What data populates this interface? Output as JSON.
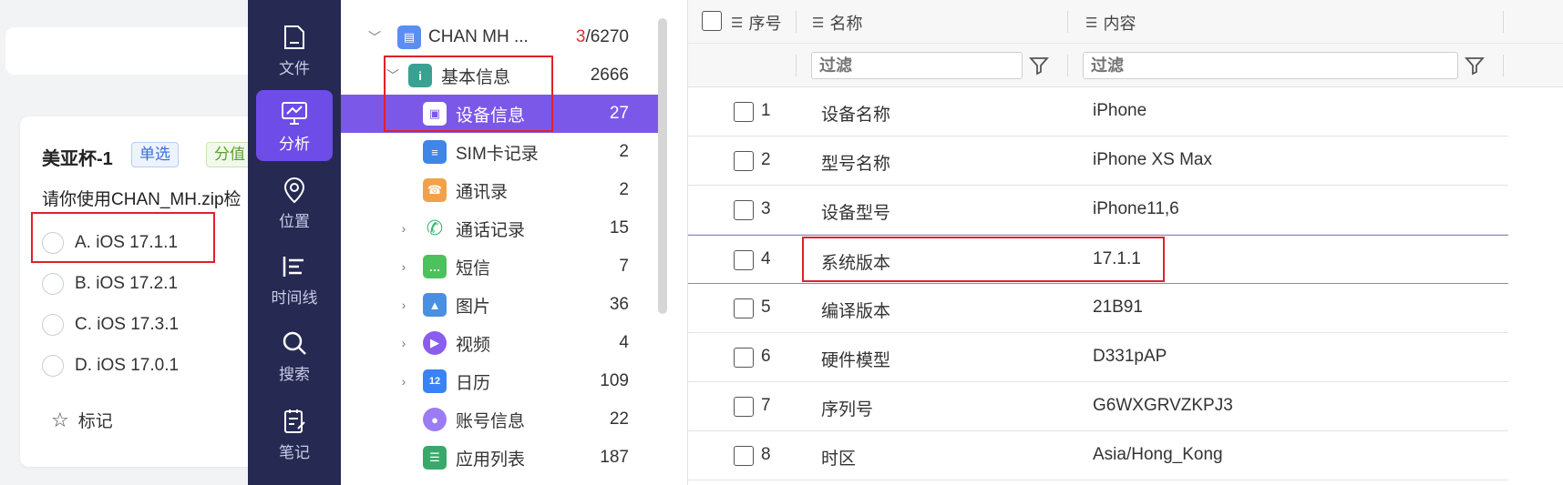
{
  "question": {
    "title": "美亚杯-1",
    "type_badge": "单选",
    "score_badge": "分值",
    "text": "请你使用CHAN_MH.zip检",
    "options": [
      "A. iOS 17.1.1",
      "B. iOS 17.2.1",
      "C. iOS 17.3.1",
      "D. iOS 17.0.1"
    ],
    "mark_label": "标记"
  },
  "nav": [
    {
      "label": "文件",
      "icon": "file-icon"
    },
    {
      "label": "分析",
      "icon": "monitor-icon"
    },
    {
      "label": "位置",
      "icon": "location-icon"
    },
    {
      "label": "时间线",
      "icon": "timeline-icon"
    },
    {
      "label": "搜索",
      "icon": "search-icon"
    },
    {
      "label": "笔记",
      "icon": "note-icon"
    }
  ],
  "tree": {
    "root": {
      "label": "CHAN MH ...",
      "count_highlight": "3",
      "count_rest": "/6270"
    },
    "items": [
      {
        "label": "基本信息",
        "count": "2666",
        "icon": "info-icon",
        "color": "#3aa192"
      },
      {
        "label": "设备信息",
        "count": "27",
        "icon": "device-icon",
        "color": "#5b8ef0"
      },
      {
        "label": "SIM卡记录",
        "count": "2",
        "icon": "sim-icon",
        "color": "#3f86e6"
      },
      {
        "label": "通讯录",
        "count": "2",
        "icon": "contacts-icon",
        "color": "#f0a24a"
      },
      {
        "label": "通话记录",
        "count": "15",
        "icon": "phone-icon",
        "color": "#3cb371"
      },
      {
        "label": "短信",
        "count": "7",
        "icon": "sms-icon",
        "color": "#4cc25c"
      },
      {
        "label": "图片",
        "count": "36",
        "icon": "image-icon",
        "color": "#4a90e2"
      },
      {
        "label": "视频",
        "count": "4",
        "icon": "video-icon",
        "color": "#8a5cf0"
      },
      {
        "label": "日历",
        "count": "109",
        "icon": "calendar-icon",
        "color": "#3b82f6"
      },
      {
        "label": "账号信息",
        "count": "22",
        "icon": "account-icon",
        "color": "#9b7cf5"
      },
      {
        "label": "应用列表",
        "count": "187",
        "icon": "app-list-icon",
        "color": "#39a96b"
      }
    ]
  },
  "table": {
    "headers": {
      "seq": "序号",
      "name": "名称",
      "content": "内容"
    },
    "filter_placeholder": "过滤",
    "rows": [
      {
        "num": "1",
        "name": "设备名称",
        "content": "iPhone"
      },
      {
        "num": "2",
        "name": "型号名称",
        "content": "iPhone XS Max"
      },
      {
        "num": "3",
        "name": "设备型号",
        "content": "iPhone11,6"
      },
      {
        "num": "4",
        "name": "系统版本",
        "content": "17.1.1"
      },
      {
        "num": "5",
        "name": "编译版本",
        "content": "21B91"
      },
      {
        "num": "6",
        "name": "硬件模型",
        "content": "D331pAP"
      },
      {
        "num": "7",
        "name": "序列号",
        "content": "G6WXGRVZKPJ3"
      },
      {
        "num": "8",
        "name": "时区",
        "content": "Asia/Hong_Kong"
      }
    ]
  },
  "colors": {
    "nav_bg": "#262a52",
    "accent": "#7c58e9",
    "annotation": "#e0202c"
  }
}
